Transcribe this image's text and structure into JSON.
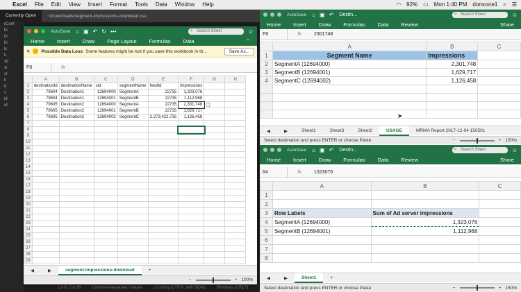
{
  "menubar": {
    "app": "Excel",
    "items": [
      "File",
      "Edit",
      "View",
      "Insert",
      "Format",
      "Tools",
      "Data",
      "Window",
      "Help"
    ],
    "battery": "92%",
    "clock": "Mon 1:40 PM",
    "user": "domoore1"
  },
  "bg_editor": {
    "tab1": "Currently Open",
    "tab2": "~/Downloads/segment-impressions-download.csv",
    "sidebar_rows": [
      "(Conf",
      "bi",
      "bi",
      "bi",
      "lc",
      "li",
      "sb",
      "sl",
      "sr",
      "li",
      "tr",
      "v",
      "id",
      "id"
    ],
    "status": [
      "Ln 6, Col 36",
      "Common-separated Values",
      "Lf (Unix) (UTF-8, with BOM)",
      "Windows (CRLF)"
    ]
  },
  "left_win": {
    "autosave": "AutoSave",
    "title": "segment-impressions-download.csv",
    "search_placeholder": "Search Sheet",
    "ribbon": [
      "Home",
      "Insert",
      "Draw",
      "Page Layout",
      "Formulas",
      "Data"
    ],
    "info_title": "Possible Data Loss",
    "info_text": "Some features might be lost if you save this workbook in th...",
    "save_as": "Save As...",
    "namebox": "F8",
    "fx": "fx",
    "formula_value": "",
    "cols": [
      "A",
      "B",
      "C",
      "D",
      "E",
      "F",
      "G",
      "H"
    ],
    "rows": [
      [
        "destinationId",
        "destinationName",
        "sid",
        "segmentName",
        "feedId",
        "impressions",
        "",
        ""
      ],
      [
        "79604",
        "Destination1",
        "12694000",
        "SegmentA",
        "22735",
        "1,323,076",
        "",
        ""
      ],
      [
        "79604",
        "Destination1",
        "12694001",
        "SegmentB",
        "22735",
        "1,112,968",
        "",
        ""
      ],
      [
        "79605",
        "Destination2",
        "12694000",
        "SegmentA",
        "22735",
        "2,301,748",
        "",
        ""
      ],
      [
        "79605",
        "Destination2",
        "12694001",
        "SegmentB",
        "22735",
        "1,629,717",
        "",
        ""
      ],
      [
        "79605",
        "Destination2",
        "12694002",
        "SegmentC",
        "2,273,422,735",
        "1,126,458",
        "",
        ""
      ]
    ],
    "sheet_tab": "segment-impressions-download",
    "zoom": "100%"
  },
  "top_right": {
    "title": "Destin...",
    "search_placeholder": "Search Sheet",
    "ribbon": [
      "Home",
      "Insert",
      "Draw",
      "Formulas",
      "Data",
      "Review"
    ],
    "share": "Share",
    "namebox": "F8",
    "fx": "fx",
    "formula_value": "2301748",
    "cols": [
      "A",
      "B",
      "C"
    ],
    "header": [
      "Segment Name",
      "Impressions"
    ],
    "rows": [
      [
        "SegmentA (12694000)",
        "2,301,748"
      ],
      [
        "SegmentB (12694001)",
        "1,629,717"
      ],
      [
        "SegmentC (12694002)",
        "1,126,458"
      ]
    ],
    "tabs": [
      "Sheet1",
      "Sheet3",
      "Sheet2",
      "USAGE",
      "MRMA Report 2017-12-04 150501"
    ],
    "status": "Select destination and press ENTER or choose Paste",
    "zoom": "150%"
  },
  "bottom_right": {
    "title": "Destin...",
    "search_placeholder": "Search Sheet",
    "ribbon": [
      "Home",
      "Insert",
      "Draw",
      "Formulas",
      "Data",
      "Review"
    ],
    "share": "Share",
    "namebox": "84",
    "fx": "fx",
    "formula_value": "1323076",
    "cols": [
      "A",
      "B",
      "C"
    ],
    "row3": [
      "Row Labels",
      "Sum of Ad server impressions"
    ],
    "rows": [
      [
        "SegmentA (12694000)",
        "1,323,076"
      ],
      [
        "SegmentB (12694001)",
        "1,112,968"
      ]
    ],
    "tab": "Sheet1",
    "status": "Select destination and press ENTER or choose Paste",
    "zoom": "150%"
  }
}
